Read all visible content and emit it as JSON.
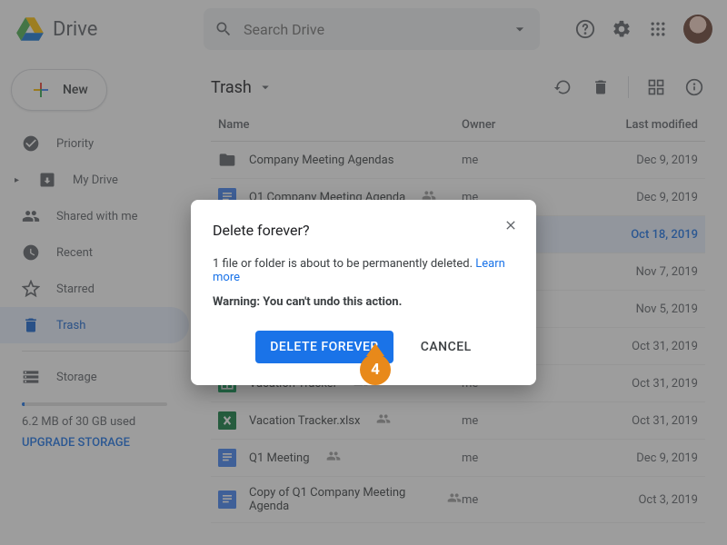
{
  "app": {
    "name": "Drive"
  },
  "search": {
    "placeholder": "Search Drive"
  },
  "new_button": "New",
  "sidebar": {
    "items": [
      {
        "label": "Priority"
      },
      {
        "label": "My Drive"
      },
      {
        "label": "Shared with me"
      },
      {
        "label": "Recent"
      },
      {
        "label": "Starred"
      },
      {
        "label": "Trash"
      },
      {
        "label": "Storage"
      }
    ],
    "storage_text": "6.2 MB of 30 GB used",
    "upgrade": "UPGRADE STORAGE"
  },
  "content": {
    "title": "Trash",
    "columns": {
      "name": "Name",
      "owner": "Owner",
      "modified": "Last modified"
    },
    "rows": [
      {
        "type": "folder",
        "name": "Company Meeting Agendas",
        "shared": false,
        "owner": "me",
        "modified": "Dec 9, 2019",
        "selected": false
      },
      {
        "type": "doc",
        "name": "Q1 Company Meeting Agenda",
        "shared": true,
        "owner": "me",
        "modified": "Dec 9, 2019",
        "selected": false
      },
      {
        "type": "doc",
        "name": "",
        "shared": false,
        "owner": "",
        "modified": "Oct 18, 2019",
        "selected": true
      },
      {
        "type": "doc",
        "name": "",
        "shared": false,
        "owner": "",
        "modified": "Nov 7, 2019",
        "selected": false
      },
      {
        "type": "doc",
        "name": "",
        "shared": false,
        "owner": "",
        "modified": "Nov 5, 2019",
        "selected": false
      },
      {
        "type": "doc",
        "name": "",
        "shared": false,
        "owner": "",
        "modified": "Oct 31, 2019",
        "selected": false
      },
      {
        "type": "sheet",
        "name": "Vacation Tracker",
        "shared": true,
        "owner": "me",
        "modified": "Oct 31, 2019",
        "selected": false
      },
      {
        "type": "xlsx",
        "name": "Vacation Tracker.xlsx",
        "shared": true,
        "owner": "me",
        "modified": "Oct 31, 2019",
        "selected": false
      },
      {
        "type": "doc",
        "name": "Q1 Meeting",
        "shared": true,
        "owner": "me",
        "modified": "Dec 9, 2019",
        "selected": false
      },
      {
        "type": "doc",
        "name": "Copy of Q1 Company Meeting Agenda",
        "shared": true,
        "owner": "me",
        "modified": "Oct 3, 2019",
        "selected": false
      }
    ]
  },
  "dialog": {
    "title": "Delete forever?",
    "body": "1 file or folder is about to be permanently deleted. ",
    "learn_more": "Learn more",
    "warning": "Warning: You can't undo this action.",
    "primary": "DELETE FOREVER",
    "secondary": "CANCEL"
  },
  "callout": {
    "number": "4"
  }
}
